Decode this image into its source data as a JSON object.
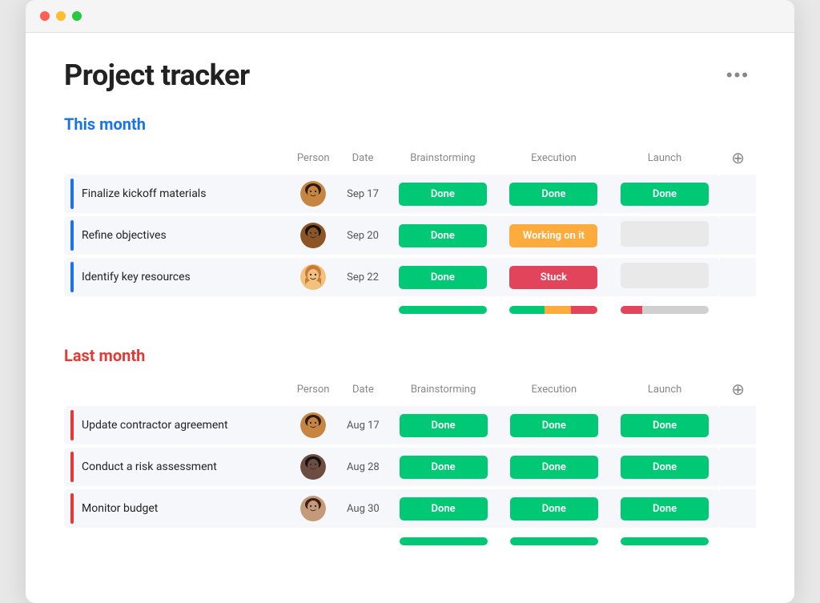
{
  "window": {
    "title": "Project tracker"
  },
  "page": {
    "title": "Project tracker",
    "more_icon": "•••"
  },
  "sections": [
    {
      "id": "this-month",
      "title": "This month",
      "color": "blue",
      "columns": [
        "Person",
        "Date",
        "Brainstorming",
        "Execution",
        "Launch"
      ],
      "rows": [
        {
          "task": "Finalize kickoff materials",
          "person_color": "#5b3a29",
          "person_initials": "A",
          "date": "Sep 17",
          "brainstorming": "Done",
          "execution": "Done",
          "launch": "Done",
          "brainstorming_status": "done",
          "execution_status": "done",
          "launch_status": "done"
        },
        {
          "task": "Refine objectives",
          "person_color": "#3a2a1a",
          "person_initials": "B",
          "date": "Sep 20",
          "brainstorming": "Done",
          "execution": "Working on it",
          "launch": "",
          "brainstorming_status": "done",
          "execution_status": "working",
          "launch_status": "empty"
        },
        {
          "task": "Identify key resources",
          "person_color": "#c97b5b",
          "person_initials": "C",
          "date": "Sep 22",
          "brainstorming": "Done",
          "execution": "Stuck",
          "launch": "",
          "brainstorming_status": "done",
          "execution_status": "stuck",
          "launch_status": "empty"
        }
      ],
      "summary": {
        "brainstorming": [
          {
            "color": "green",
            "pct": 100
          }
        ],
        "execution": [
          {
            "color": "green",
            "pct": 40
          },
          {
            "color": "orange",
            "pct": 30
          },
          {
            "color": "red",
            "pct": 30
          }
        ],
        "launch": [
          {
            "color": "red",
            "pct": 25
          },
          {
            "color": "gray",
            "pct": 75
          }
        ]
      }
    },
    {
      "id": "last-month",
      "title": "Last month",
      "color": "red",
      "columns": [
        "Person",
        "Date",
        "Brainstorming",
        "Execution",
        "Launch"
      ],
      "rows": [
        {
          "task": "Update contractor agreement",
          "person_color": "#5b3a29",
          "person_initials": "D",
          "date": "Aug 17",
          "brainstorming": "Done",
          "execution": "Done",
          "launch": "Done",
          "brainstorming_status": "done",
          "execution_status": "done",
          "launch_status": "done"
        },
        {
          "task": "Conduct a risk assessment",
          "person_color": "#2a2a2a",
          "person_initials": "E",
          "date": "Aug 28",
          "brainstorming": "Done",
          "execution": "Done",
          "launch": "Done",
          "brainstorming_status": "done",
          "execution_status": "done",
          "launch_status": "done"
        },
        {
          "task": "Monitor budget",
          "person_color": "#5a3a2a",
          "person_initials": "F",
          "date": "Aug 30",
          "brainstorming": "Done",
          "execution": "Done",
          "launch": "Done",
          "brainstorming_status": "done",
          "execution_status": "done",
          "launch_status": "done"
        }
      ],
      "summary": {
        "brainstorming": [
          {
            "color": "green",
            "pct": 100
          }
        ],
        "execution": [
          {
            "color": "green",
            "pct": 100
          }
        ],
        "launch": [
          {
            "color": "green",
            "pct": 100
          }
        ]
      }
    }
  ],
  "avatars": {
    "A": {
      "bg": "#8d6e63",
      "hair": "#3e2723",
      "skin": "#d4956a"
    },
    "B": {
      "bg": "#5d4037",
      "hair": "#1a0000",
      "skin": "#8d6e53"
    },
    "C": {
      "bg": "#e0ac69",
      "hair": "#c07030",
      "skin": "#f5cba7"
    },
    "D": {
      "bg": "#8d6e63",
      "hair": "#3e2723",
      "skin": "#d4956a"
    },
    "E": {
      "bg": "#4e342e",
      "hair": "#111",
      "skin": "#6d4c41"
    },
    "F": {
      "bg": "#7b5e57",
      "hair": "#2e1810",
      "skin": "#c49a7a"
    }
  }
}
